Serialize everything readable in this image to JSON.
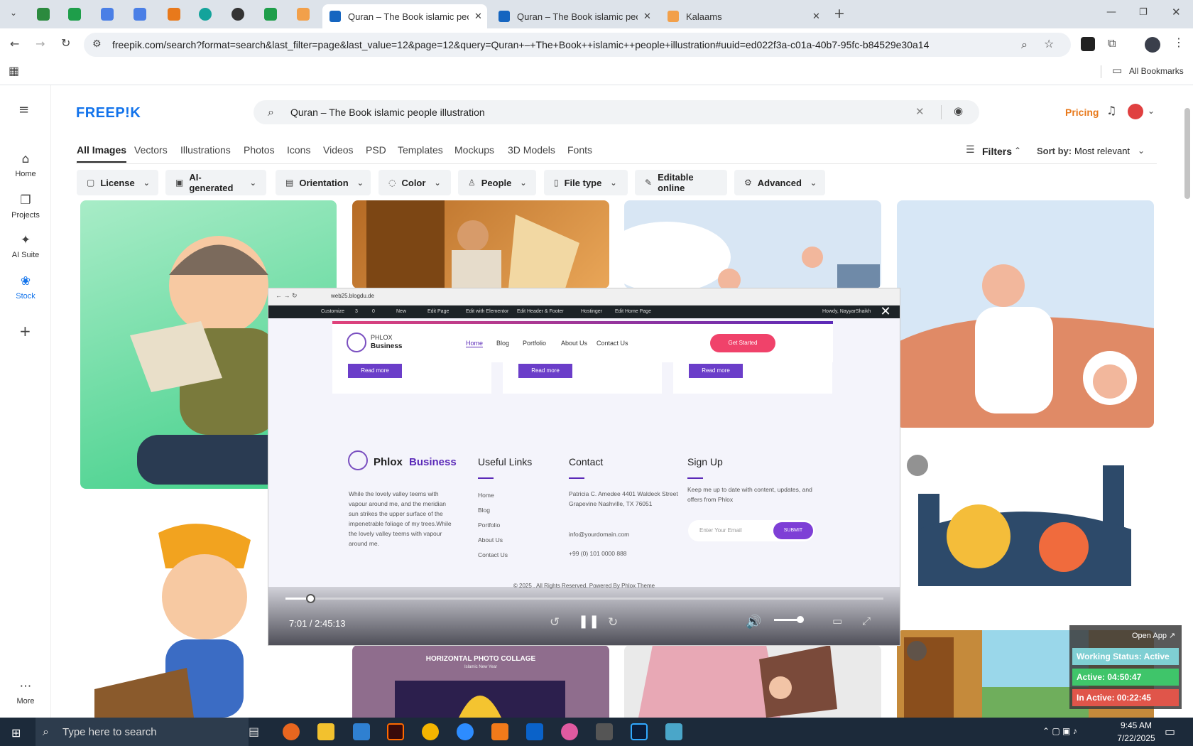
{
  "browser": {
    "tabs": [
      {
        "title": "Quran – The Book islamic peop",
        "active": true
      },
      {
        "title": "Quran – The Book islamic peop",
        "active": false
      },
      {
        "title": "Kalaams",
        "active": false
      }
    ],
    "url": "freepik.com/search?format=search&last_filter=page&last_value=12&page=12&query=Quran+–+The+Book++islamic++people+illustration#uuid=ed022f3a-c01a-40b7-95fc-b84529e30a14",
    "all_bookmarks": "All Bookmarks"
  },
  "freepik": {
    "logo": "FREEP!K",
    "search_value": "Quran – The Book  islamic  people illustration",
    "pricing": "Pricing",
    "nav": [
      {
        "label": "Home",
        "icon": "home-icon"
      },
      {
        "label": "Projects",
        "icon": "projects-icon"
      },
      {
        "label": "AI Suite",
        "icon": "ai-suite-icon"
      },
      {
        "label": "Stock",
        "icon": "stock-icon"
      },
      {
        "label": "More",
        "icon": "more-icon"
      }
    ],
    "categories": [
      "All Images",
      "Vectors",
      "Illustrations",
      "Photos",
      "Icons",
      "Videos",
      "PSD",
      "Templates",
      "Mockups",
      "3D Models",
      "Fonts"
    ],
    "filters_label": "Filters",
    "sort_label": "Sort by:",
    "sort_value": "Most relevant",
    "chips": [
      "License",
      "AI-generated",
      "Orientation",
      "Color",
      "People",
      "File type",
      "Editable online",
      "Advanced"
    ],
    "collage_title": "HORIZONTAL PHOTO COLLAGE",
    "collage_sub": "Islamic New Year"
  },
  "video": {
    "inner_url": "web25.blogdu.de",
    "wp_bar": [
      "Customize",
      "3",
      "0",
      "New",
      "Edit Page",
      "Edit with Elementor",
      "Edit Header & Footer",
      "Hostinger",
      "Edit Home Page"
    ],
    "wp_user": "Howdy, NayyarShaikh",
    "site_logo_line1": "PHLOX",
    "site_logo_line2": "Business",
    "site_nav": [
      "Home",
      "Blog",
      "Portfolio",
      "About Us",
      "Contact Us"
    ],
    "get_started": "Get Started",
    "read_more": "Read more",
    "footer_brand1": "Phlox",
    "footer_brand2": "Business",
    "footer_about": "While the lovely valley teems with vapour around me, and the meridian sun strikes the upper surface of the impenetrable foliage of my trees.While the lovely valley teems with vapour around me.",
    "useful_links_title": "Useful Links",
    "useful_links": [
      "Home",
      "Blog",
      "Portfolio",
      "About Us",
      "Contact Us"
    ],
    "contact_title": "Contact",
    "contact_address": "Patricia C. Amedee 4401 Waldeck Street Grapevine Nashville, TX 76051",
    "contact_email": "info@yourdomain.com",
    "contact_phone": "+99 (0) 101 0000 888",
    "signup_title": "Sign Up",
    "signup_text": "Keep me up to date with content, updates, and offers from Phlox",
    "email_placeholder": "Enter Your Email",
    "submit": "SUBMIT",
    "copyright": "© 2025 . All Rights Reserved. Powered By Phlox Theme",
    "time": "7:01 / 2:45:13",
    "progress": 0.042
  },
  "widget": {
    "open_app": "Open App ↗",
    "working": "Working Status: Active",
    "active": "Active: 04:50:47",
    "inactive": "In Active: 00:22:45"
  },
  "taskbar": {
    "search_placeholder": "Type here to search",
    "time": "9:45 AM",
    "date": "7/22/2025"
  },
  "colors": {
    "freepik_blue": "#1273eb",
    "pricing_orange": "#e8791b",
    "phlox_purple": "#5b2ab8",
    "get_started": "#f0426a"
  }
}
